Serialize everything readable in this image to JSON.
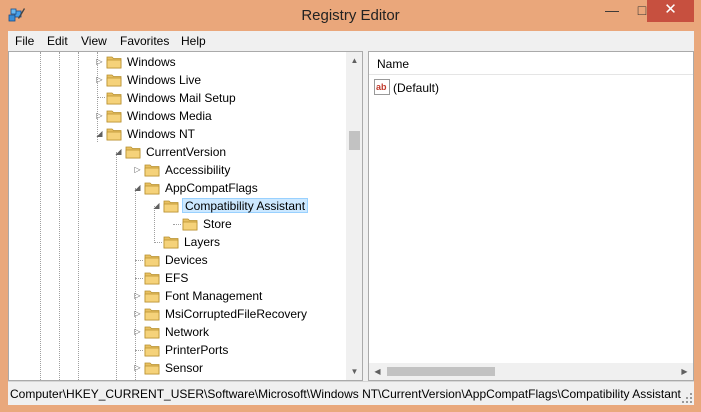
{
  "window": {
    "title": "Registry Editor",
    "minimize": "—",
    "maximize": "□",
    "close": "✕"
  },
  "menu": [
    "File",
    "Edit",
    "View",
    "Favorites",
    "Help"
  ],
  "tree": {
    "nodes": [
      {
        "label": "Windows",
        "expander": "▷"
      },
      {
        "label": "Windows Live",
        "expander": "▷"
      },
      {
        "label": "Windows Mail Setup",
        "expander": ""
      },
      {
        "label": "Windows Media",
        "expander": "▷"
      },
      {
        "label": "Windows NT",
        "expander": "◢"
      },
      {
        "label": "CurrentVersion",
        "expander": "◢"
      },
      {
        "label": "Accessibility",
        "expander": "▷"
      },
      {
        "label": "AppCompatFlags",
        "expander": "◢"
      },
      {
        "label": "Compatibility Assistant",
        "expander": "◢",
        "selected": true
      },
      {
        "label": "Store",
        "expander": ""
      },
      {
        "label": "Layers",
        "expander": ""
      },
      {
        "label": "Devices",
        "expander": ""
      },
      {
        "label": "EFS",
        "expander": ""
      },
      {
        "label": "Font Management",
        "expander": "▷"
      },
      {
        "label": "MsiCorruptedFileRecovery",
        "expander": "▷"
      },
      {
        "label": "Network",
        "expander": "▷"
      },
      {
        "label": "PrinterPorts",
        "expander": ""
      },
      {
        "label": "Sensor",
        "expander": "▷"
      }
    ],
    "scroll_up": "▲",
    "scroll_down": "▼"
  },
  "values": {
    "column_name": "Name",
    "rows": [
      {
        "name": "(Default)",
        "icon": "string-value-icon"
      }
    ],
    "scroll_left": "◀",
    "scroll_right": "▶"
  },
  "statusbar": {
    "path": "Computer\\HKEY_CURRENT_USER\\Software\\Microsoft\\Windows NT\\CurrentVersion\\AppCompatFlags\\Compatibility Assistant"
  },
  "colors": {
    "titlebar": "#eaa77b",
    "close_button": "#c7503f",
    "selection": "#cce8ff",
    "folder": "#e8c062"
  }
}
